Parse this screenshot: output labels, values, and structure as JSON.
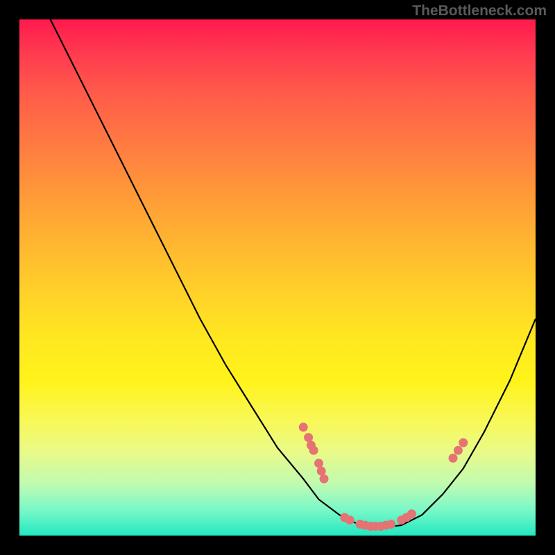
{
  "watermark": "TheBottleneck.com",
  "chart_data": {
    "type": "line",
    "title": "",
    "xlabel": "",
    "ylabel": "",
    "xlim": [
      0,
      100
    ],
    "ylim": [
      0,
      100
    ],
    "curve": [
      {
        "x": 6,
        "y": 100
      },
      {
        "x": 10,
        "y": 92
      },
      {
        "x": 15,
        "y": 82
      },
      {
        "x": 20,
        "y": 72
      },
      {
        "x": 25,
        "y": 62
      },
      {
        "x": 30,
        "y": 52
      },
      {
        "x": 35,
        "y": 42
      },
      {
        "x": 40,
        "y": 33
      },
      {
        "x": 45,
        "y": 25
      },
      {
        "x": 50,
        "y": 17
      },
      {
        "x": 55,
        "y": 11
      },
      {
        "x": 58,
        "y": 7
      },
      {
        "x": 62,
        "y": 4
      },
      {
        "x": 66,
        "y": 2
      },
      {
        "x": 70,
        "y": 1.5
      },
      {
        "x": 74,
        "y": 2
      },
      {
        "x": 78,
        "y": 4
      },
      {
        "x": 82,
        "y": 8
      },
      {
        "x": 86,
        "y": 13
      },
      {
        "x": 90,
        "y": 20
      },
      {
        "x": 95,
        "y": 30
      },
      {
        "x": 100,
        "y": 42
      }
    ],
    "dots": [
      {
        "x": 55,
        "y": 21
      },
      {
        "x": 56,
        "y": 19
      },
      {
        "x": 56.5,
        "y": 17.5
      },
      {
        "x": 57,
        "y": 16.5
      },
      {
        "x": 58,
        "y": 14
      },
      {
        "x": 58.5,
        "y": 12.5
      },
      {
        "x": 59,
        "y": 11
      },
      {
        "x": 63,
        "y": 3.5
      },
      {
        "x": 64,
        "y": 3
      },
      {
        "x": 66,
        "y": 2.2
      },
      {
        "x": 67,
        "y": 2.0
      },
      {
        "x": 68,
        "y": 1.8
      },
      {
        "x": 69,
        "y": 1.8
      },
      {
        "x": 70,
        "y": 1.8
      },
      {
        "x": 71,
        "y": 2.0
      },
      {
        "x": 72,
        "y": 2.2
      },
      {
        "x": 74,
        "y": 3.0
      },
      {
        "x": 75,
        "y": 3.5
      },
      {
        "x": 76,
        "y": 4.2
      },
      {
        "x": 84,
        "y": 15
      },
      {
        "x": 85,
        "y": 16.5
      },
      {
        "x": 86,
        "y": 18
      }
    ],
    "gradient_stops": [
      {
        "pos": 0,
        "color": "#ff1a4d"
      },
      {
        "pos": 50,
        "color": "#ffd428"
      },
      {
        "pos": 100,
        "color": "#22e8c0"
      }
    ]
  }
}
